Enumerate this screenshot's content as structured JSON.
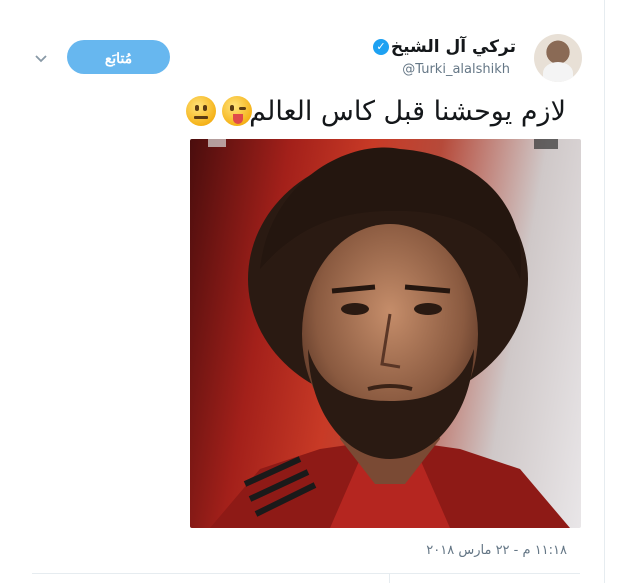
{
  "tweet": {
    "user_name": "تركي آل الشيخ",
    "handle": "@Turki_alalshikh",
    "verified_icon": "verified-badge-icon",
    "follow_label": "مُتابَع",
    "menu_icon": "chevron-down-icon",
    "text": "لازم يوحشنا قبل كاس العالم",
    "emojis": [
      "winking-face-with-tongue-icon",
      "neutral-face-icon"
    ],
    "timestamp": "١١:١٨ م - ٢٢ مارس ٢٠١٨",
    "image_icon": "photo-portrait-icon"
  },
  "colors": {
    "accent": "#1da1f2",
    "follow_button": "#67b7ef",
    "text": "#14171a",
    "secondary_text": "#657786"
  }
}
